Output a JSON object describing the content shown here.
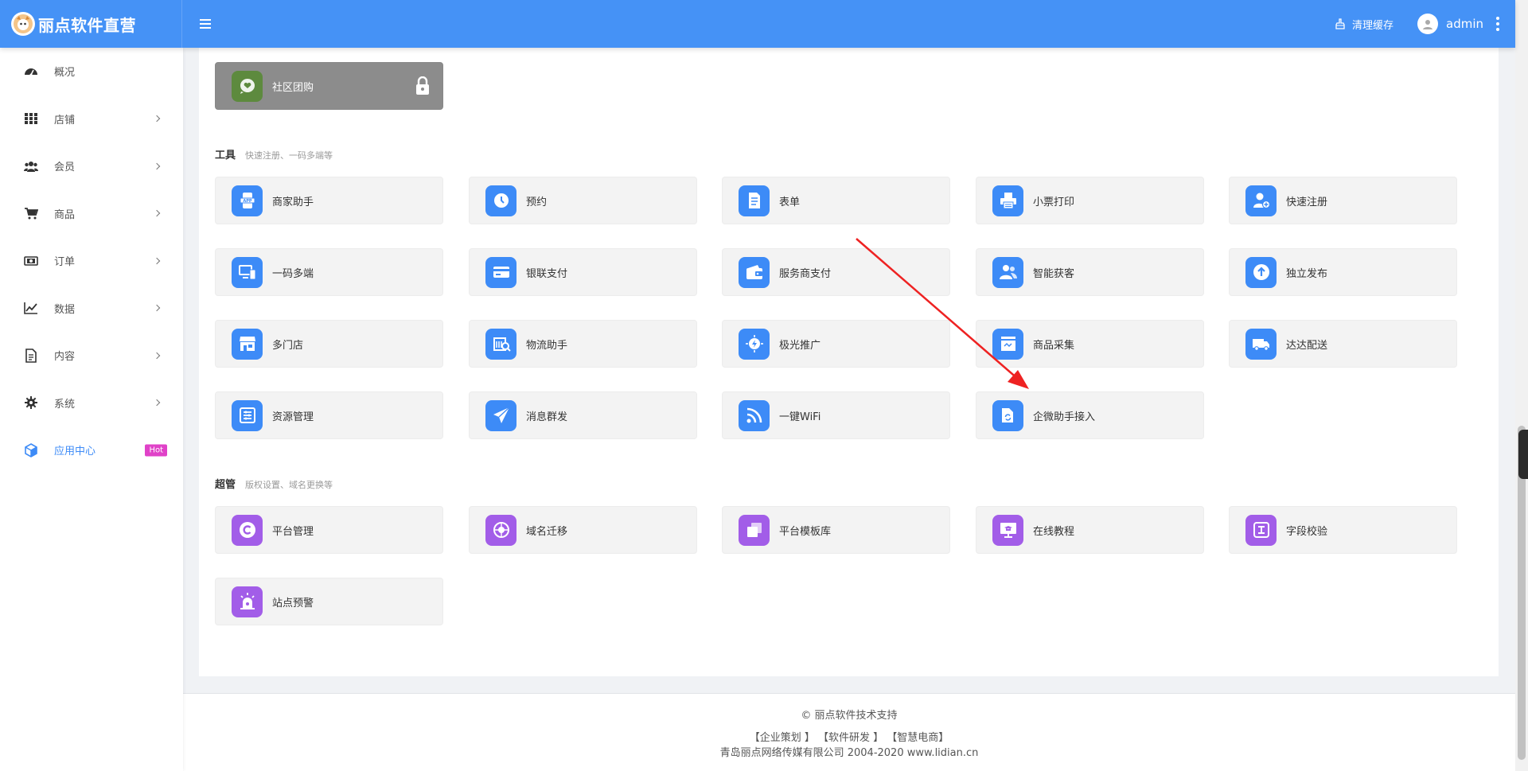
{
  "brand": {
    "title": "丽点软件直营"
  },
  "topbar": {
    "clear_cache": "清理缓存",
    "user": "admin"
  },
  "sidebar": {
    "items": [
      {
        "label": "概况",
        "icon": "dashboard-icon",
        "arrow": false
      },
      {
        "label": "店铺",
        "icon": "grid-icon",
        "arrow": true
      },
      {
        "label": "会员",
        "icon": "users-icon",
        "arrow": true
      },
      {
        "label": "商品",
        "icon": "cart-icon",
        "arrow": true
      },
      {
        "label": "订单",
        "icon": "money-icon",
        "arrow": true
      },
      {
        "label": "数据",
        "icon": "chart-icon",
        "arrow": true
      },
      {
        "label": "内容",
        "icon": "document-icon",
        "arrow": true
      },
      {
        "label": "系统",
        "icon": "gear-icon",
        "arrow": true
      },
      {
        "label": "应用中心",
        "icon": "cube-icon",
        "arrow": false,
        "active": true,
        "badge": "Hot"
      }
    ]
  },
  "top_tile": {
    "label": "社区团购",
    "icon": "chat-heart-icon",
    "locked": true
  },
  "tools": {
    "title": "工具",
    "subtitle": "快速注册、一码多端等",
    "items": [
      {
        "label": "商家助手",
        "icon": "app-phone-icon"
      },
      {
        "label": "预约",
        "icon": "clock-icon"
      },
      {
        "label": "表单",
        "icon": "form-icon"
      },
      {
        "label": "小票打印",
        "icon": "printer-icon"
      },
      {
        "label": "快速注册",
        "icon": "user-add-icon"
      },
      {
        "label": "一码多端",
        "icon": "multi-device-icon"
      },
      {
        "label": "银联支付",
        "icon": "card-icon"
      },
      {
        "label": "服务商支付",
        "icon": "wallet-icon"
      },
      {
        "label": "智能获客",
        "icon": "customers-icon"
      },
      {
        "label": "独立发布",
        "icon": "upload-icon"
      },
      {
        "label": "多门店",
        "icon": "stores-icon"
      },
      {
        "label": "物流助手",
        "icon": "logistics-icon"
      },
      {
        "label": "极光推广",
        "icon": "rocket-icon"
      },
      {
        "label": "商品采集",
        "icon": "collect-icon"
      },
      {
        "label": "达达配送",
        "icon": "truck-icon"
      },
      {
        "label": "资源管理",
        "icon": "resources-icon"
      },
      {
        "label": "消息群发",
        "icon": "send-icon"
      },
      {
        "label": "一键WiFi",
        "icon": "wifi-icon"
      },
      {
        "label": "企微助手接入",
        "icon": "folder-sync-icon"
      }
    ]
  },
  "admin": {
    "title": "超管",
    "subtitle": "版权设置、域名更换等",
    "items": [
      {
        "label": "平台管理",
        "icon": "copyright-icon"
      },
      {
        "label": "域名迁移",
        "icon": "globe-icon"
      },
      {
        "label": "平台模板库",
        "icon": "templates-icon"
      },
      {
        "label": "在线教程",
        "icon": "tutorial-icon"
      },
      {
        "label": "字段校验",
        "icon": "field-check-icon"
      },
      {
        "label": "站点预警",
        "icon": "alarm-icon"
      }
    ]
  },
  "footer": {
    "support": "© 丽点软件技术支持",
    "links": [
      "【企业策划 】",
      "【软件研发 】",
      "【智慧电商】"
    ],
    "company": "青岛丽点网络传媒有限公司 2004-2020 www.lidian.cn"
  },
  "colors": {
    "topbar": "#4592f6",
    "tool_icon": "#3d8bf7",
    "admin_icon": "#a25de8",
    "hot_badge": "#e042c8",
    "arrow": "#ee2222"
  }
}
